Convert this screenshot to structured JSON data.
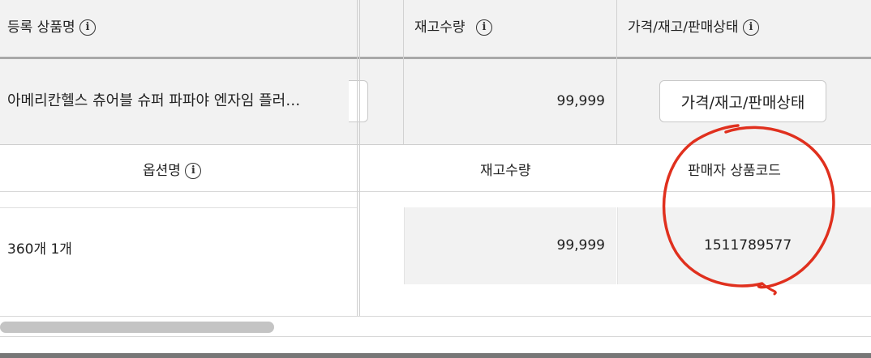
{
  "header": {
    "product_name_label": "등록 상품명",
    "stock_label": "재고수량",
    "price_status_label": "가격/재고/판매상태",
    "info_glyph": "i"
  },
  "product_row": {
    "name": "아메리칸헬스 츄어블 슈퍼 파파야 엔자임 플러…",
    "stock": "99,999",
    "price_status_button": "가격/재고/판매상태"
  },
  "option_header": {
    "option_name_label": "옵션명",
    "stock_label": "재고수량",
    "seller_code_label": "판매자 상품코드",
    "info_glyph": "i"
  },
  "option_row": {
    "option_name": "360개 1개",
    "stock": "99,999",
    "seller_code": "1511789577"
  },
  "annotation": {
    "circle_color": "#e0301e"
  }
}
